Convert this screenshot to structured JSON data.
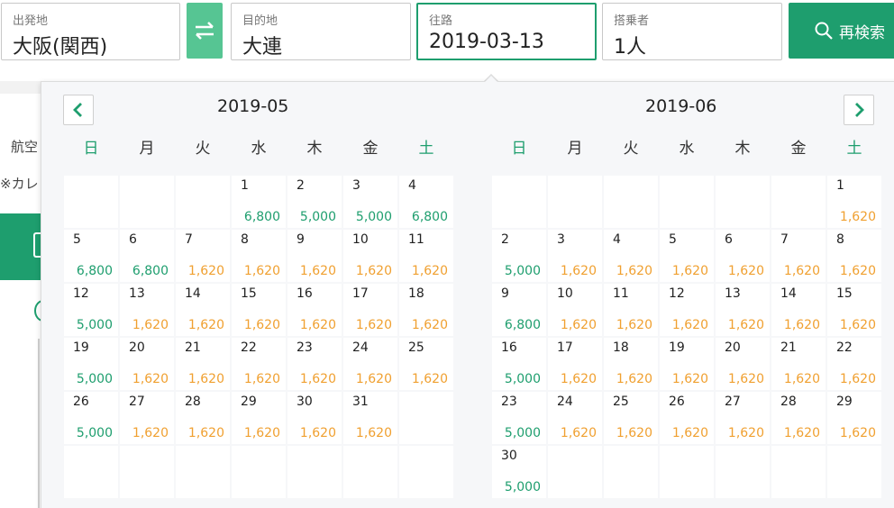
{
  "search": {
    "origin": {
      "label": "出発地",
      "value": "大阪(関西)"
    },
    "destination": {
      "label": "目的地",
      "value": "大連"
    },
    "date": {
      "label": "往路",
      "value": "2019-03-13"
    },
    "passengers": {
      "label": "搭乗者",
      "value": "1人"
    },
    "search_button": "再検索"
  },
  "background": {
    "text1": "航空",
    "text2": "※カレ"
  },
  "colors": {
    "accent": "#1e9e6e",
    "cheap": "#1e9e6e",
    "regular": "#f0a030"
  },
  "weekdays": [
    "日",
    "月",
    "火",
    "水",
    "木",
    "金",
    "土"
  ],
  "calendars": [
    {
      "title": "2019-05",
      "leading_blanks": 3,
      "days": [
        {
          "d": "1",
          "p": "6,800",
          "t": "green"
        },
        {
          "d": "2",
          "p": "5,000",
          "t": "green"
        },
        {
          "d": "3",
          "p": "5,000",
          "t": "green"
        },
        {
          "d": "4",
          "p": "6,800",
          "t": "green"
        },
        {
          "d": "5",
          "p": "6,800",
          "t": "green"
        },
        {
          "d": "6",
          "p": "6,800",
          "t": "green"
        },
        {
          "d": "7",
          "p": "1,620",
          "t": "orange"
        },
        {
          "d": "8",
          "p": "1,620",
          "t": "orange"
        },
        {
          "d": "9",
          "p": "1,620",
          "t": "orange"
        },
        {
          "d": "10",
          "p": "1,620",
          "t": "orange"
        },
        {
          "d": "11",
          "p": "1,620",
          "t": "orange"
        },
        {
          "d": "12",
          "p": "5,000",
          "t": "green"
        },
        {
          "d": "13",
          "p": "1,620",
          "t": "orange"
        },
        {
          "d": "14",
          "p": "1,620",
          "t": "orange"
        },
        {
          "d": "15",
          "p": "1,620",
          "t": "orange"
        },
        {
          "d": "16",
          "p": "1,620",
          "t": "orange"
        },
        {
          "d": "17",
          "p": "1,620",
          "t": "orange"
        },
        {
          "d": "18",
          "p": "1,620",
          "t": "orange"
        },
        {
          "d": "19",
          "p": "5,000",
          "t": "green"
        },
        {
          "d": "20",
          "p": "1,620",
          "t": "orange"
        },
        {
          "d": "21",
          "p": "1,620",
          "t": "orange"
        },
        {
          "d": "22",
          "p": "1,620",
          "t": "orange"
        },
        {
          "d": "23",
          "p": "1,620",
          "t": "orange"
        },
        {
          "d": "24",
          "p": "1,620",
          "t": "orange"
        },
        {
          "d": "25",
          "p": "1,620",
          "t": "orange"
        },
        {
          "d": "26",
          "p": "5,000",
          "t": "green"
        },
        {
          "d": "27",
          "p": "1,620",
          "t": "orange"
        },
        {
          "d": "28",
          "p": "1,620",
          "t": "orange"
        },
        {
          "d": "29",
          "p": "1,620",
          "t": "orange"
        },
        {
          "d": "30",
          "p": "1,620",
          "t": "orange"
        },
        {
          "d": "31",
          "p": "1,620",
          "t": "orange"
        }
      ]
    },
    {
      "title": "2019-06",
      "leading_blanks": 6,
      "days": [
        {
          "d": "1",
          "p": "1,620",
          "t": "orange"
        },
        {
          "d": "2",
          "p": "5,000",
          "t": "green"
        },
        {
          "d": "3",
          "p": "1,620",
          "t": "orange"
        },
        {
          "d": "4",
          "p": "1,620",
          "t": "orange"
        },
        {
          "d": "5",
          "p": "1,620",
          "t": "orange"
        },
        {
          "d": "6",
          "p": "1,620",
          "t": "orange"
        },
        {
          "d": "7",
          "p": "1,620",
          "t": "orange"
        },
        {
          "d": "8",
          "p": "1,620",
          "t": "orange"
        },
        {
          "d": "9",
          "p": "6,800",
          "t": "green"
        },
        {
          "d": "10",
          "p": "1,620",
          "t": "orange"
        },
        {
          "d": "11",
          "p": "1,620",
          "t": "orange"
        },
        {
          "d": "12",
          "p": "1,620",
          "t": "orange"
        },
        {
          "d": "13",
          "p": "1,620",
          "t": "orange"
        },
        {
          "d": "14",
          "p": "1,620",
          "t": "orange"
        },
        {
          "d": "15",
          "p": "1,620",
          "t": "orange"
        },
        {
          "d": "16",
          "p": "5,000",
          "t": "green"
        },
        {
          "d": "17",
          "p": "1,620",
          "t": "orange"
        },
        {
          "d": "18",
          "p": "1,620",
          "t": "orange"
        },
        {
          "d": "19",
          "p": "1,620",
          "t": "orange"
        },
        {
          "d": "20",
          "p": "1,620",
          "t": "orange"
        },
        {
          "d": "21",
          "p": "1,620",
          "t": "orange"
        },
        {
          "d": "22",
          "p": "1,620",
          "t": "orange"
        },
        {
          "d": "23",
          "p": "5,000",
          "t": "green"
        },
        {
          "d": "24",
          "p": "1,620",
          "t": "orange"
        },
        {
          "d": "25",
          "p": "1,620",
          "t": "orange"
        },
        {
          "d": "26",
          "p": "1,620",
          "t": "orange"
        },
        {
          "d": "27",
          "p": "1,620",
          "t": "orange"
        },
        {
          "d": "28",
          "p": "1,620",
          "t": "orange"
        },
        {
          "d": "29",
          "p": "1,620",
          "t": "orange"
        },
        {
          "d": "30",
          "p": "5,000",
          "t": "green"
        }
      ]
    }
  ]
}
